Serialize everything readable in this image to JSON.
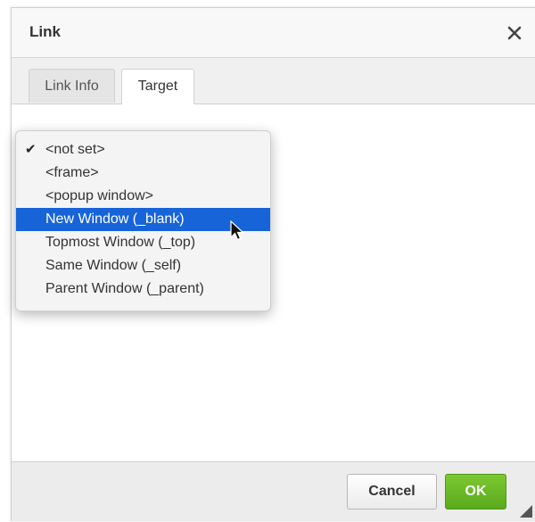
{
  "dialog": {
    "title": "Link",
    "close_icon": "close-icon"
  },
  "tabs": [
    {
      "label": "Link Info",
      "active": false
    },
    {
      "label": "Target",
      "active": true
    }
  ],
  "target_dropdown": {
    "selected_value": "<not set>",
    "highlighted_value": "New Window (_blank)",
    "options": [
      "<not set>",
      "<frame>",
      "<popup window>",
      "New Window (_blank)",
      "Topmost Window (_top)",
      "Same Window (_self)",
      "Parent Window (_parent)"
    ],
    "check_icon": "checkmark-icon"
  },
  "footer": {
    "cancel_label": "Cancel",
    "ok_label": "OK"
  },
  "colors": {
    "highlight": "#1764d9",
    "ok_button": "#6cbb27"
  }
}
